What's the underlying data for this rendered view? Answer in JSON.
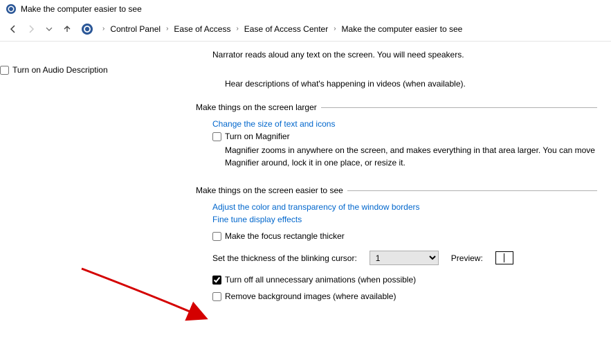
{
  "window": {
    "title": "Make the computer easier to see"
  },
  "breadcrumb": {
    "items": [
      "Control Panel",
      "Ease of Access",
      "Ease of Access Center",
      "Make the computer easier to see"
    ]
  },
  "intro": {
    "narrator_desc": "Narrator reads aloud any text on the screen. You will need speakers.",
    "audio_desc_checkbox": "Turn on Audio Description",
    "audio_desc_help": "Hear descriptions of what's happening in videos (when available)."
  },
  "larger": {
    "legend": "Make things on the screen larger",
    "link_text_icons": "Change the size of text and icons",
    "magnifier_checkbox": "Turn on Magnifier",
    "magnifier_help": "Magnifier zooms in anywhere on the screen, and makes everything in that area larger. You can move Magnifier around, lock it in one place, or resize it."
  },
  "easier": {
    "legend": "Make things on the screen easier to see",
    "link_borders": "Adjust the color and transparency of the window borders",
    "link_display": "Fine tune display effects",
    "focus_rect_checkbox": "Make the focus rectangle thicker",
    "cursor_label": "Set the thickness of the blinking cursor:",
    "cursor_value": "1",
    "preview_label": "Preview:",
    "animations_checkbox": "Turn off all unnecessary animations (when possible)",
    "bg_images_checkbox": "Remove background images (where available)"
  }
}
